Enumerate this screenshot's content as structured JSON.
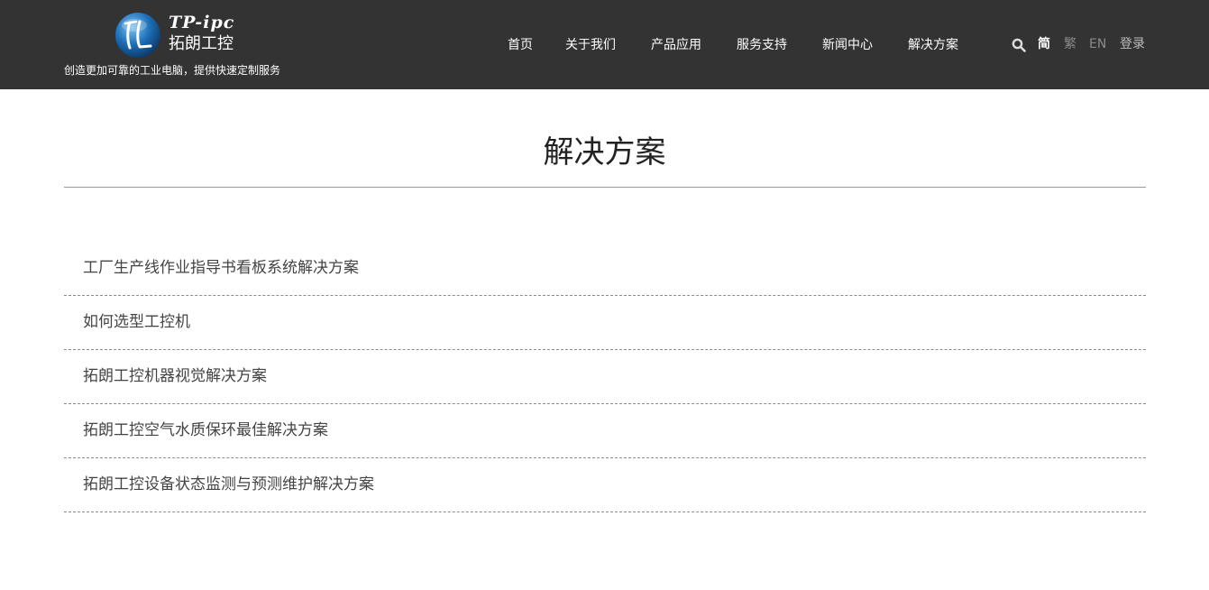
{
  "header": {
    "logo_en": "TP-ipc",
    "logo_cn": "拓朗工控",
    "tagline": "创造更加可靠的工业电脑，提供快速定制服务",
    "nav": [
      {
        "label": "首页"
      },
      {
        "label": "关于我们"
      },
      {
        "label": "产品应用"
      },
      {
        "label": "服务支持"
      },
      {
        "label": "新闻中心"
      },
      {
        "label": "解决方案"
      }
    ],
    "search_icon": "search-icon",
    "lang": {
      "simplified": "简",
      "traditional": "繁",
      "english": "EN"
    },
    "login_label": "登录",
    "colors": {
      "header_bg": "#333333",
      "logo_blue": "#1e6fb8"
    }
  },
  "main": {
    "title": "解决方案",
    "items": [
      {
        "label": "工厂生产线作业指导书看板系统解决方案"
      },
      {
        "label": "如何选型工控机"
      },
      {
        "label": "拓朗工控机器视觉解决方案"
      },
      {
        "label": "拓朗工控空气水质保环最佳解决方案"
      },
      {
        "label": "拓朗工控设备状态监测与预测维护解决方案"
      }
    ]
  }
}
